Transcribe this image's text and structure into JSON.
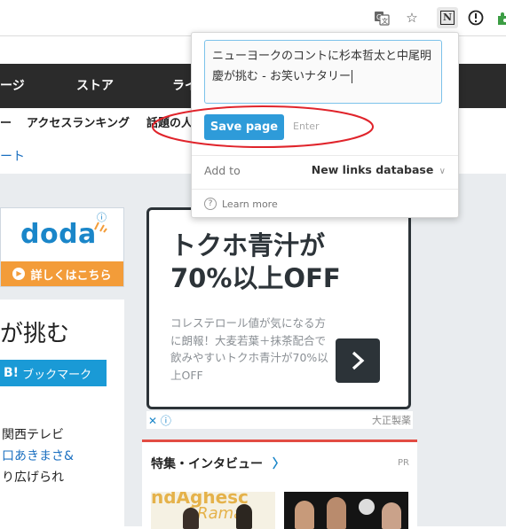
{
  "browser": {
    "icons": [
      "translate-icon",
      "star-icon",
      "notion-extension-icon",
      "info-circle-icon",
      "puzzle-extension-icon"
    ],
    "notion_glyph": "N"
  },
  "site_nav": {
    "items": [
      "ージ",
      "ストア",
      "ライ"
    ]
  },
  "subnav": {
    "items": [
      "ー",
      "アクセスランキング",
      "話題の人"
    ]
  },
  "link_row": {
    "text": "ート"
  },
  "doda_ad": {
    "logo": "doda",
    "cta": "詳しくはこちら",
    "info_glyph": "ⓘ",
    "brand_color": "#1a86c9",
    "cta_color": "#f39c39"
  },
  "article": {
    "title_fragment": "が挑む",
    "bookmark_prefix": "B!",
    "bookmark_label": "ブックマーク",
    "lines": [
      {
        "text": "関西テレビ",
        "color": "#222"
      },
      {
        "text": "口あきまさ&",
        "color": "#1a6fc0"
      },
      {
        "text": "り広げられ",
        "color": "#222"
      }
    ]
  },
  "aojiru_ad": {
    "headline_1": "トクホ青汁が",
    "headline_2": "70%以上OFF",
    "body": "コレステロール値が気になる方に朗報！大麦若葉＋抹茶配合で飲みやすいトクホ青汁が70%以上OFF",
    "sponsor": "大正製薬",
    "adchoices": "✕ ⓘ"
  },
  "feature": {
    "title": "特集・インタビュー",
    "pr": "PR",
    "accent": "#e24c43",
    "thumb1_caption": "ndAghesc",
    "thumb1_caption2": "f Rama"
  },
  "notion_popup": {
    "title_value": "ニューヨークのコントに杉本哲太と中尾明慶が挑む - お笑いナタリー",
    "save_label": "Save page",
    "enter_hint": "Enter",
    "add_to_label": "Add to",
    "database": "New links database",
    "learn_more": "Learn more",
    "accent": "#2e9bd9"
  },
  "annotation": {
    "color": "#e0242b"
  }
}
